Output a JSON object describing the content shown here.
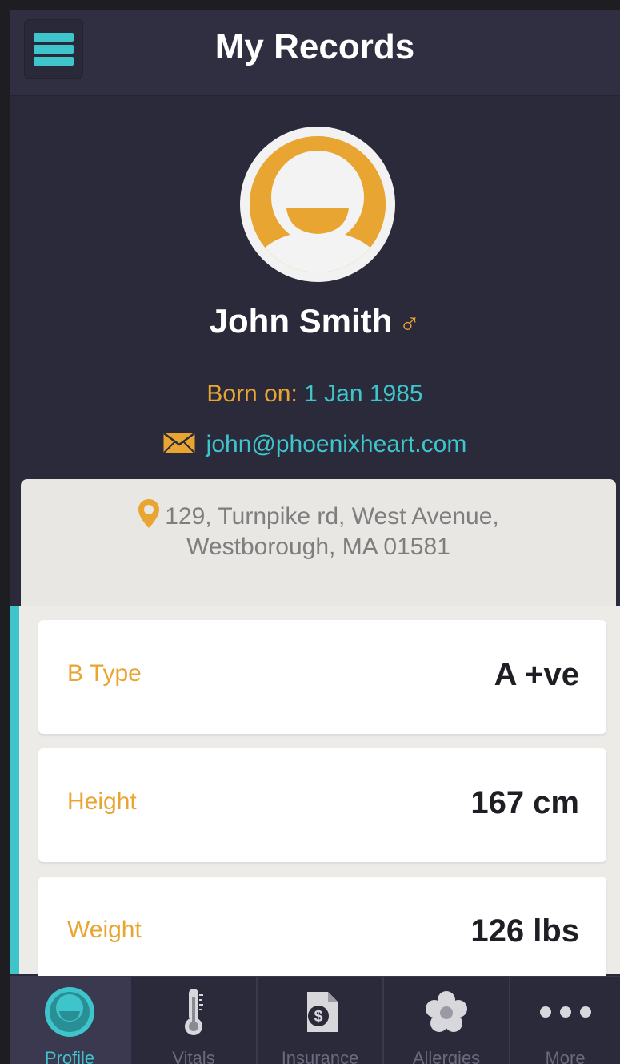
{
  "header": {
    "title": "My Records",
    "menu_icon": "hamburger-menu-icon"
  },
  "profile": {
    "name": "John Smith",
    "gender_symbol": "♂",
    "born_label": "Born on:",
    "born_value": "1 Jan 1985",
    "email": "john@phoenixheart.com",
    "address_line1": "129, Turnpike rd, West Avenue,",
    "address_line2": "Westborough, MA 01581"
  },
  "details": [
    {
      "label": "B Type",
      "value": "A +ve"
    },
    {
      "label": "Height",
      "value": "167 cm"
    },
    {
      "label": "Weight",
      "value": "126 lbs"
    }
  ],
  "tabs": [
    {
      "label": "Profile",
      "icon": "profile-icon",
      "active": true
    },
    {
      "label": "Vitals",
      "icon": "thermometer-icon",
      "active": false
    },
    {
      "label": "Insurance",
      "icon": "insurance-document-icon",
      "active": false
    },
    {
      "label": "Allergies",
      "icon": "flower-icon",
      "active": false
    },
    {
      "label": "More",
      "icon": "more-dots-icon",
      "active": false
    }
  ],
  "colors": {
    "accent": "#3ec5cc",
    "highlight": "#e9a531",
    "background": "#2b2a3b"
  }
}
